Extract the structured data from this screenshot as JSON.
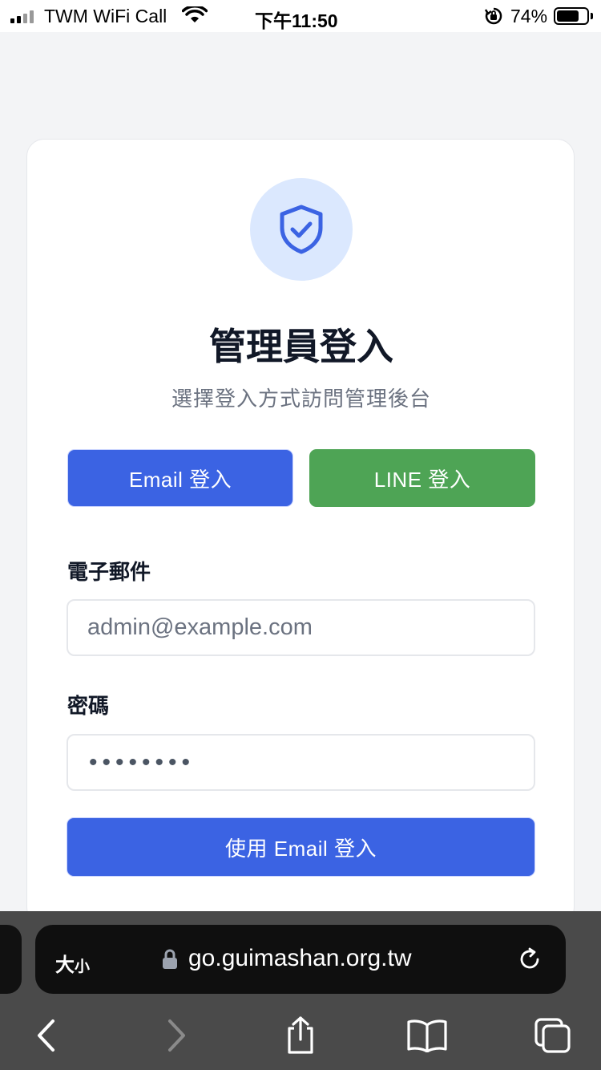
{
  "status_bar": {
    "carrier": "TWM WiFi Call",
    "time": "下午11:50",
    "battery_percent": "74%",
    "battery_level": 0.74,
    "icons": [
      "signal-icon",
      "wifi-icon",
      "rotation-lock-icon",
      "battery-icon"
    ]
  },
  "login": {
    "icon": "shield-check-icon",
    "title": "管理員登入",
    "subtitle": "選擇登入方式訪問管理後台",
    "methods": {
      "email_label": "Email 登入",
      "line_label": "LINE 登入",
      "selected": "email"
    },
    "email": {
      "label": "電子郵件",
      "placeholder": "admin@example.com",
      "value": ""
    },
    "password": {
      "label": "密碼",
      "masked_value": "••••••••"
    },
    "submit_label": "使用 Email 登入"
  },
  "colors": {
    "primary": "#3b63e3",
    "line_green": "#4ea455",
    "icon_bg": "#dbe8fe"
  },
  "browser": {
    "text_size_label_big": "大",
    "text_size_label_small": "小",
    "url": "go.guimashan.org.tw",
    "icons": [
      "lock-icon",
      "reload-icon",
      "back-icon",
      "forward-icon",
      "share-icon",
      "bookmarks-icon",
      "tabs-icon"
    ]
  }
}
